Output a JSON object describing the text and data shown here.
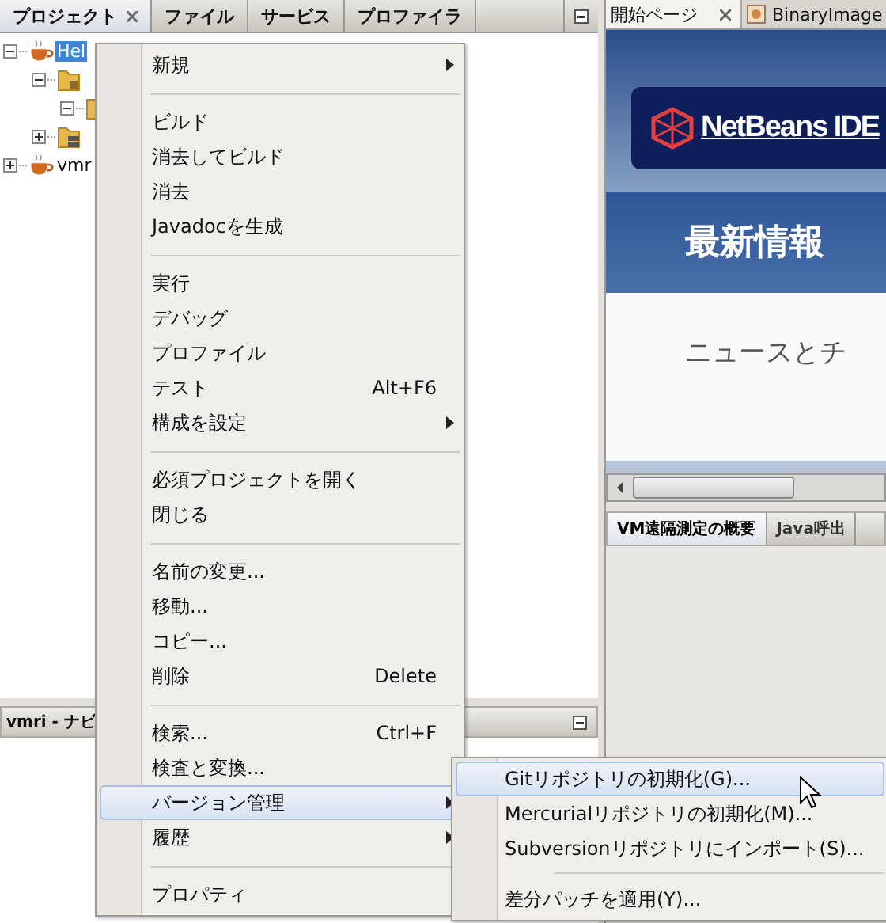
{
  "left_tabs": [
    {
      "label": "プロジェクト",
      "selected": true,
      "closable": true
    },
    {
      "label": "ファイル",
      "selected": false,
      "closable": false
    },
    {
      "label": "サービス",
      "selected": false,
      "closable": false
    },
    {
      "label": "プロファイラ",
      "selected": false,
      "closable": false
    }
  ],
  "tree": [
    {
      "label": "Hel",
      "kind": "project",
      "selected": true,
      "expanded": true,
      "children": [
        {
          "kind": "package-folder",
          "expanded": true,
          "children": [
            {
              "kind": "folder",
              "expanded": true
            }
          ]
        },
        {
          "kind": "library-folder",
          "expanded": false
        }
      ]
    },
    {
      "label": "vmr",
      "kind": "project",
      "selected": false,
      "expanded": false
    }
  ],
  "navigator": {
    "title": "vmri - ナビ"
  },
  "right_tabs": [
    {
      "label": "開始ページ",
      "selected": true,
      "closable": true,
      "icon": false
    },
    {
      "label": "BinaryImage",
      "selected": false,
      "closable": false,
      "icon": true
    }
  ],
  "start_page": {
    "logo_text": "NetBeans IDE",
    "heading": "最新情報",
    "subheading": "ニュースとチ"
  },
  "bottom_tabs": [
    {
      "label": "VM遠隔測定の概要",
      "selected": true
    },
    {
      "label": "Java呼出",
      "selected": false
    }
  ],
  "context_menu": {
    "items": [
      {
        "kind": "item",
        "label": "新規",
        "submenu": true,
        "selected": false
      },
      {
        "kind": "separator"
      },
      {
        "kind": "item",
        "label": "ビルド",
        "submenu": false,
        "selected": false
      },
      {
        "kind": "item",
        "label": "消去してビルド",
        "submenu": false,
        "selected": false
      },
      {
        "kind": "item",
        "label": "消去",
        "submenu": false,
        "selected": false
      },
      {
        "kind": "item",
        "label": "Javadocを生成",
        "submenu": false,
        "selected": false
      },
      {
        "kind": "separator"
      },
      {
        "kind": "item",
        "label": "実行",
        "submenu": false,
        "selected": false
      },
      {
        "kind": "item",
        "label": "デバッグ",
        "submenu": false,
        "selected": false
      },
      {
        "kind": "item",
        "label": "プロファイル",
        "submenu": false,
        "selected": false
      },
      {
        "kind": "item",
        "label": "テスト",
        "shortcut": "Alt+F6",
        "submenu": false,
        "selected": false
      },
      {
        "kind": "item",
        "label": "構成を設定",
        "submenu": true,
        "selected": false
      },
      {
        "kind": "separator"
      },
      {
        "kind": "item",
        "label": "必須プロジェクトを開く",
        "submenu": false,
        "selected": false
      },
      {
        "kind": "item",
        "label": "閉じる",
        "submenu": false,
        "selected": false
      },
      {
        "kind": "separator"
      },
      {
        "kind": "item",
        "label": "名前の変更...",
        "submenu": false,
        "selected": false
      },
      {
        "kind": "item",
        "label": "移動...",
        "submenu": false,
        "selected": false
      },
      {
        "kind": "item",
        "label": "コピー...",
        "submenu": false,
        "selected": false
      },
      {
        "kind": "item",
        "label": "削除",
        "shortcut": "Delete",
        "submenu": false,
        "selected": false
      },
      {
        "kind": "separator"
      },
      {
        "kind": "item",
        "label": "検索...",
        "shortcut": "Ctrl+F",
        "submenu": false,
        "selected": false
      },
      {
        "kind": "item",
        "label": "検査と変換...",
        "submenu": false,
        "selected": false
      },
      {
        "kind": "item",
        "label": "バージョン管理",
        "submenu": true,
        "selected": true
      },
      {
        "kind": "item",
        "label": "履歴",
        "submenu": true,
        "selected": false
      },
      {
        "kind": "separator"
      },
      {
        "kind": "item",
        "label": "プロパティ",
        "submenu": false,
        "selected": false
      }
    ]
  },
  "submenu": {
    "items": [
      {
        "kind": "item",
        "label": "Gitリポジトリの初期化(G)...",
        "selected": true
      },
      {
        "kind": "item",
        "label": "Mercurialリポジトリの初期化(M)...",
        "selected": false
      },
      {
        "kind": "item",
        "label": "Subversionリポジトリにインポート(S)...",
        "selected": false
      },
      {
        "kind": "separator"
      },
      {
        "kind": "item",
        "label": "差分パッチを適用(Y)...",
        "selected": false
      }
    ]
  }
}
